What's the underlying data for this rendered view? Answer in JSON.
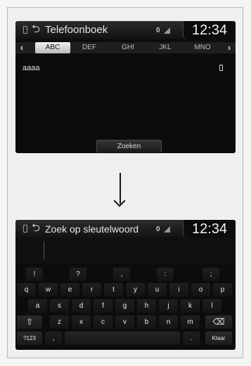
{
  "screen1": {
    "title": "Telefoonboek",
    "status_text": "0",
    "clock": "12:34",
    "tabs": [
      "ABC",
      "DEF",
      "GHI",
      "JKL",
      "MNO"
    ],
    "active_tab_index": 0,
    "contacts": [
      {
        "name": "aaaa"
      }
    ],
    "search_button": "Zoeken"
  },
  "screen2": {
    "title": "Zoek op sleutelwoord",
    "status_text": "0",
    "clock": "12:34",
    "keyboard": {
      "symbols_row": [
        "!",
        "?",
        ",",
        ":",
        ";"
      ],
      "row1": [
        "q",
        "w",
        "e",
        "r",
        "t",
        "y",
        "u",
        "i",
        "o",
        "p"
      ],
      "row2": [
        "a",
        "s",
        "d",
        "f",
        "g",
        "h",
        "j",
        "k",
        "l"
      ],
      "row3": [
        "z",
        "x",
        "c",
        "v",
        "b",
        "n",
        "m"
      ],
      "bottom": {
        "mode": "?123",
        "comma": ",",
        "period": ".",
        "done": "Klaar"
      }
    }
  },
  "icons": {
    "phone": "phone-icon",
    "back": "back-icon",
    "bluetooth": "bluetooth-icon",
    "signal": "signal-icon",
    "shift": "shift-icon",
    "backspace": "backspace-icon",
    "arrow_down": "arrow-down-icon"
  }
}
